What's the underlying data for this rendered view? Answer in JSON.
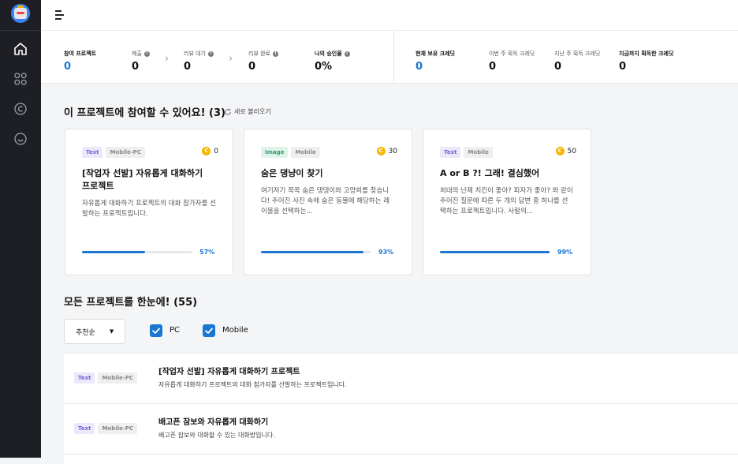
{
  "stats": [
    {
      "label": "참여 프로젝트",
      "value": "0",
      "blue": true,
      "info": false,
      "bold": true
    },
    {
      "label": "제출",
      "value": "0",
      "info": true
    },
    {
      "label": "리뷰 대기",
      "value": "0",
      "info": true
    },
    {
      "label": "리뷰 완료",
      "value": "0",
      "info": true
    },
    {
      "label": "나의 승인율",
      "value": "0%",
      "info": true
    },
    {
      "label": "현재 보유 크레딧",
      "value": "0",
      "blue": true,
      "bold": true
    },
    {
      "label": "이번 주 획득 크레딧",
      "value": "0"
    },
    {
      "label": "지난 주 획득 크레딧",
      "value": "0"
    },
    {
      "label": "지금까지 획득한 크레딧",
      "value": "0",
      "bold": true
    }
  ],
  "available": {
    "title": "이 프로젝트에 참여할 수 있어요! (3)",
    "refresh": "새로 불러오기",
    "cards": [
      {
        "type": "Text",
        "platform": "Mobile-PC",
        "credit": "0",
        "title": "[작업자 선발] 자유롭게 대화하기 프로젝트",
        "desc": "자유롭게 대화하기 프로젝트의 대화 참가자를 선발하는 프로젝트입니다.",
        "progress": 0.57,
        "percent": "57%"
      },
      {
        "type": "Image",
        "platform": "Mobile",
        "credit": "30",
        "title": "숨은 댕냥이 찾기",
        "desc": "여기저기 꼭꼭 숨은 댕댕이와 고양희를 찾습니다! 주어진 사진 속에 숨은 동물에 해당하는 레이블을 선택하는...",
        "progress": 0.93,
        "percent": "93%"
      },
      {
        "type": "Text",
        "platform": "Mobile",
        "credit": "50",
        "title": "A or B ?! 그래! 결심했어",
        "desc": "희대의 난제 치킨이 좋아? 피자가 좋아? 와 같이 주어진 질문에 따른 두 개의 답변 중 하나를 선택하는 프로젝트입니다. 사람의...",
        "progress": 0.99,
        "percent": "99%"
      }
    ]
  },
  "all": {
    "title": "모든 프로젝트를 한눈에! (55)",
    "sort": "추천순",
    "filters": [
      "PC",
      "Mobile"
    ],
    "rows": [
      {
        "type": "Text",
        "platform": "Mobile-PC",
        "title": "[작업자 선발] 자유롭게 대화하기 프로젝트",
        "desc": "자유롭게 대화하기 프로젝트의 대화 참가자를 선발하는 프로젝트입니다."
      },
      {
        "type": "Text",
        "platform": "Mobile-PC",
        "title": "배고픈 잠보와 자유롭게 대화하기",
        "desc": "배고픈 잠보와 대화할 수 있는 대화방입니다."
      }
    ]
  },
  "icons": {
    "home": "home-icon",
    "grid": "grid-icon",
    "credit": "copyright-icon",
    "smile": "smile-icon"
  },
  "colors": {
    "accent": "#1976d2",
    "sidebar": "#1e1f24",
    "coin": "#f5b400"
  }
}
